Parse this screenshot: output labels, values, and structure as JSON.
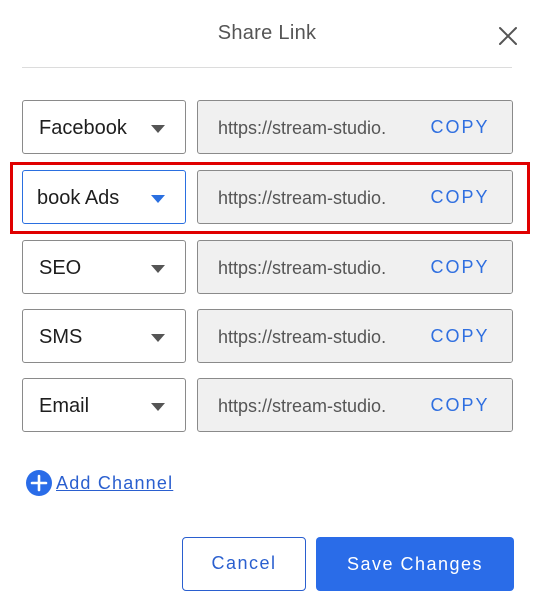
{
  "dialog": {
    "title": "Share Link",
    "close_icon": "close-icon"
  },
  "channels": [
    {
      "name": "Facebook",
      "url": "https://stream-studio.",
      "copy_label": "COPY"
    },
    {
      "name": "book Ads",
      "url": "https://stream-studio.",
      "copy_label": "COPY"
    },
    {
      "name": "SEO",
      "url": "https://stream-studio.",
      "copy_label": "COPY"
    },
    {
      "name": "SMS",
      "url": "https://stream-studio.",
      "copy_label": "COPY"
    },
    {
      "name": "Email",
      "url": "https://stream-studio.",
      "copy_label": "COPY"
    }
  ],
  "add_channel": {
    "label": "Add Channel",
    "icon": "plus-circle-icon"
  },
  "actions": {
    "cancel_label": "Cancel",
    "save_label": "Save Changes"
  },
  "colors": {
    "accent": "#2a6ce8",
    "link": "#2a5fcf",
    "highlight": "#e00000",
    "field_bg": "#f0f0f0"
  }
}
